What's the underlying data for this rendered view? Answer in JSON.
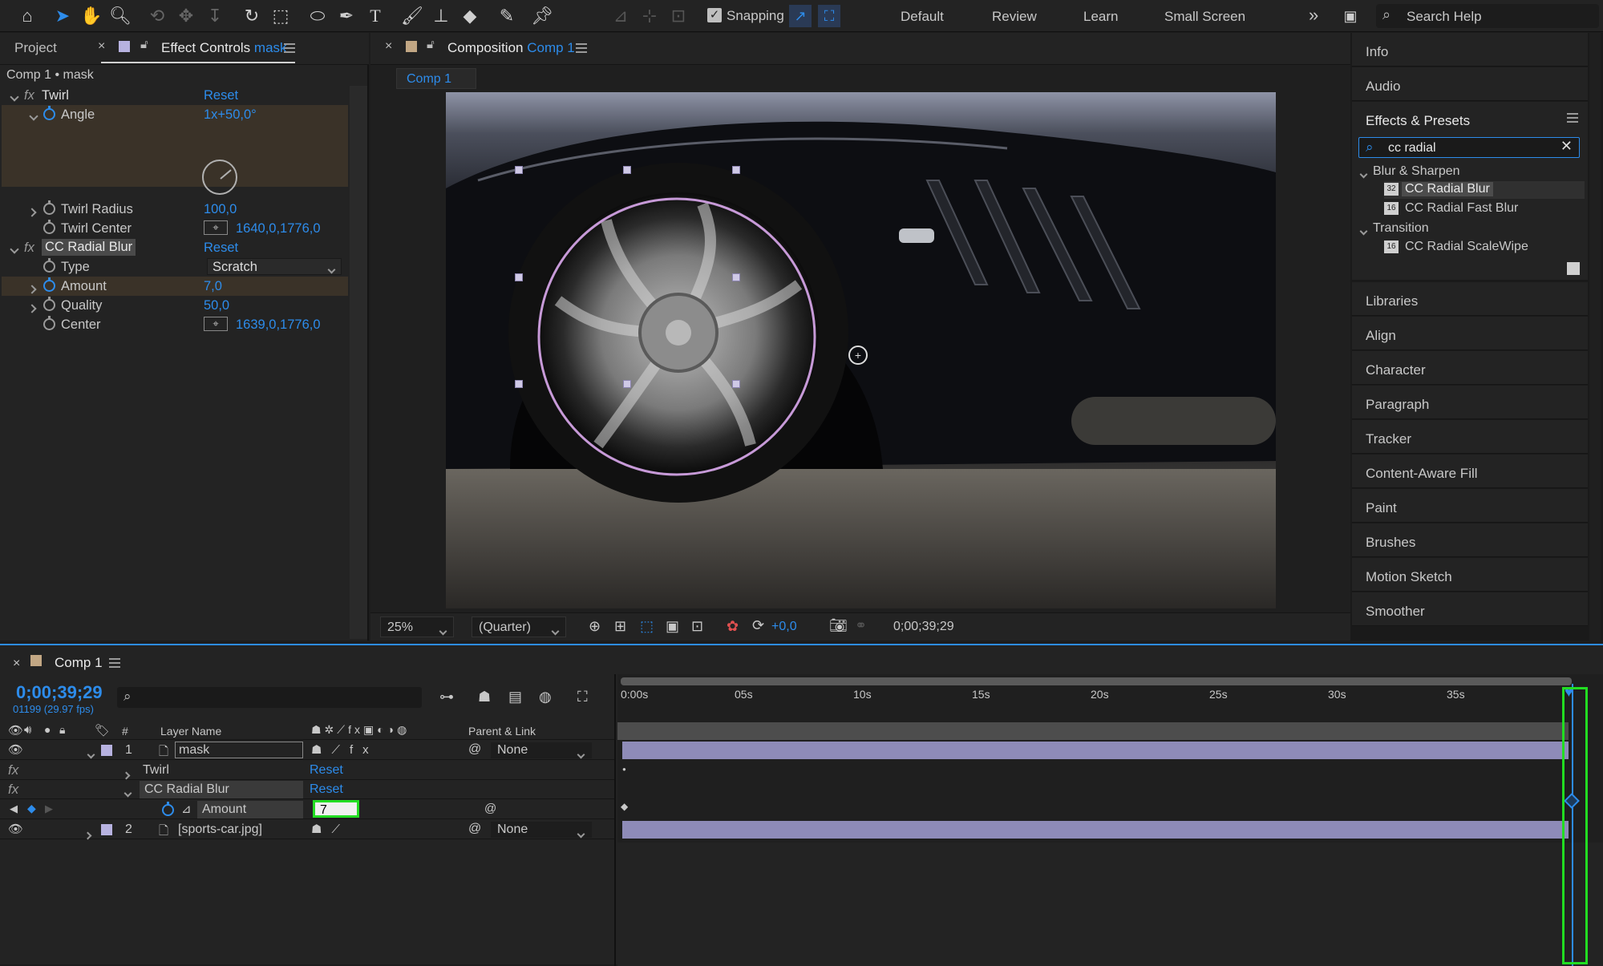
{
  "toolbar": {
    "snapping_label": "Snapping",
    "workspaces": [
      "Default",
      "Review",
      "Learn",
      "Small Screen"
    ],
    "more": "»",
    "search_help": "Search Help"
  },
  "left_panel": {
    "tab_project": "Project",
    "tab_effect_prefix": "Effect Controls",
    "tab_effect_layer": "mask",
    "breadcrumb": "Comp 1 • mask",
    "effects": {
      "twirl": {
        "name": "Twirl",
        "reset": "Reset"
      },
      "angle": {
        "label": "Angle",
        "value": "1x+50,0°"
      },
      "twirl_radius": {
        "label": "Twirl Radius",
        "value": "100,0"
      },
      "twirl_center": {
        "label": "Twirl Center",
        "value": "1640,0,1776,0"
      },
      "radial_blur": {
        "name": "CC Radial Blur",
        "reset": "Reset"
      },
      "type": {
        "label": "Type",
        "value": "Scratch"
      },
      "amount": {
        "label": "Amount",
        "value": "7,0"
      },
      "quality": {
        "label": "Quality",
        "value": "50,0"
      },
      "center": {
        "label": "Center",
        "value": "1639,0,1776,0"
      }
    }
  },
  "composition": {
    "tab_prefix": "Composition",
    "tab_name": "Comp 1",
    "subtab": "Comp 1",
    "zoom": "25%",
    "resolution": "(Quarter)",
    "exposure": "+0,0",
    "timecode": "0;00;39;29"
  },
  "right_panel": {
    "info": "Info",
    "audio": "Audio",
    "effects_presets": "Effects & Presets",
    "search_value": "cc radial",
    "groups": [
      {
        "name": "Blur & Sharpen",
        "items": [
          "CC Radial Blur",
          "CC Radial Fast Blur"
        ]
      },
      {
        "name": "Transition",
        "items": [
          "CC Radial ScaleWipe"
        ]
      }
    ],
    "panels": [
      "Libraries",
      "Align",
      "Character",
      "Paragraph",
      "Tracker",
      "Content-Aware Fill",
      "Paint",
      "Brushes",
      "Motion Sketch",
      "Smoother"
    ]
  },
  "timeline": {
    "tab": "Comp 1",
    "timecode": "0;00;39;29",
    "frame_info": "01199 (29.97 fps)",
    "col_num": "#",
    "col_layer_name": "Layer Name",
    "col_parent": "Parent & Link",
    "ruler": [
      "0:00s",
      "05s",
      "10s",
      "15s",
      "20s",
      "25s",
      "30s",
      "35s"
    ],
    "layers": [
      {
        "num": "1",
        "name": "mask",
        "parent": "None"
      },
      {
        "num": "2",
        "name": "[sports-car.jpg]",
        "parent": "None"
      }
    ],
    "sub_twirl": "Twirl",
    "sub_twirl_reset": "Reset",
    "sub_blur": "CC Radial Blur",
    "sub_blur_reset": "Reset",
    "amount_label": "Amount",
    "amount_edit": "7",
    "highlight_color": "#22dd22"
  }
}
